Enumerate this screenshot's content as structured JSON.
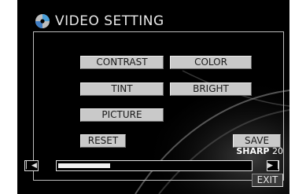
{
  "title": "VIDEO SETTING",
  "icons": {
    "title": "disc-icon",
    "prev": "skip-back-icon",
    "next": "skip-forward-icon"
  },
  "buttons": {
    "contrast": "CONTRAST",
    "color": "COLOR",
    "tint": "TINT",
    "bright": "BRIGHT",
    "picture": "PICTURE",
    "reset": "RESET",
    "save": "SAVE",
    "exit": "EXIT"
  },
  "readout": {
    "label": "SHARP",
    "value": "20"
  },
  "slider": {
    "level": 0.27
  },
  "colors": {
    "screen": "#000000",
    "button": "#c9c9c9",
    "text": "#e8e8e8"
  }
}
